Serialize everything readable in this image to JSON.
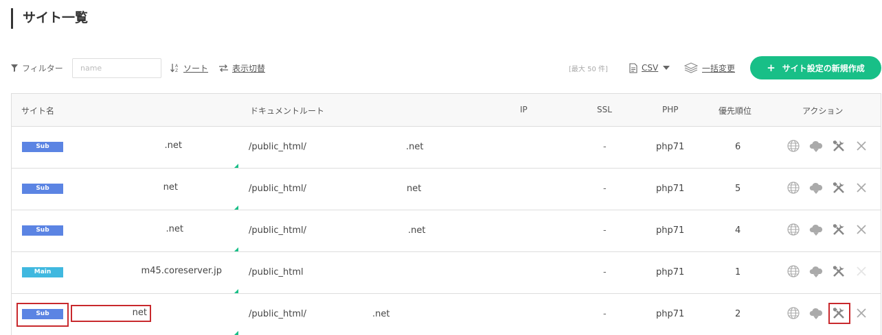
{
  "page": {
    "title": "サイト一覧"
  },
  "toolbar": {
    "filter_label": "フィルター",
    "filter_placeholder": "name",
    "sort_label": "ソート",
    "toggle_label": "表示切替",
    "max_label": "[最大 50 件]",
    "csv_label": "CSV",
    "bulk_label": "一括変更",
    "new_button_label": "サイト設定の新規作成",
    "accent_color": "#18bf87"
  },
  "table": {
    "columns": {
      "site_name": "サイト名",
      "document_root": "ドキュメントルート",
      "ip": "IP",
      "ssl": "SSL",
      "php": "PHP",
      "priority": "優先順位",
      "actions": "アクション"
    },
    "rows": [
      {
        "type": "Sub",
        "site_name": ".net",
        "docroot": "/public_html/",
        "docroot_suffix": ".net",
        "ssl": "-",
        "php": "php71",
        "priority": "6"
      },
      {
        "type": "Sub",
        "site_name": "net",
        "docroot": "/public_html/",
        "docroot_suffix": "net",
        "ssl": "-",
        "php": "php71",
        "priority": "5"
      },
      {
        "type": "Sub",
        "site_name": ".net",
        "docroot": "/public_html/",
        "docroot_suffix": ".net",
        "ssl": "-",
        "php": "php71",
        "priority": "4"
      },
      {
        "type": "Main",
        "site_name": "m45.coreserver.jp",
        "docroot": "/public_html",
        "docroot_suffix": "",
        "ssl": "-",
        "php": "php71",
        "priority": "1"
      },
      {
        "type": "Sub",
        "site_name": "net",
        "docroot": "/public_html/",
        "docroot_suffix": ".net",
        "ssl": "-",
        "php": "php71",
        "priority": "2"
      }
    ],
    "action_icons": [
      "globe-icon",
      "cloud-download-icon",
      "tools-icon",
      "close-icon"
    ]
  },
  "colors": {
    "sub_badge": "#5b84e3",
    "main_badge": "#40b8df",
    "highlight": "#c8282c"
  }
}
